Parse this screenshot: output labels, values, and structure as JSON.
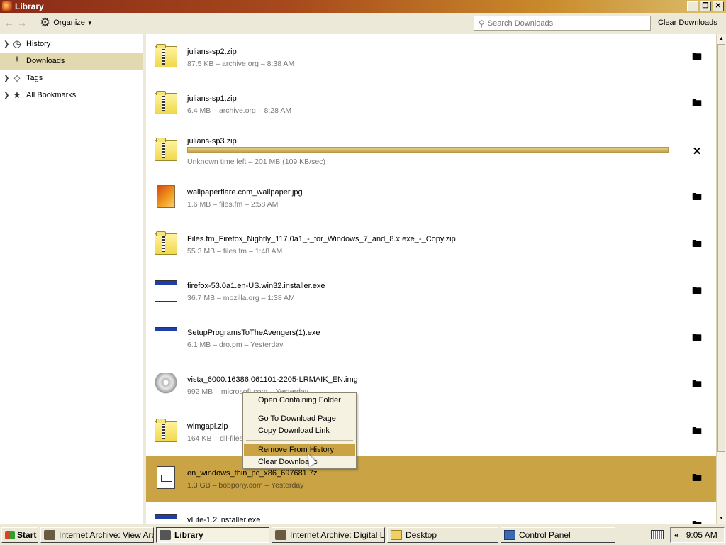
{
  "window": {
    "title": "Library"
  },
  "toolbar": {
    "organize_label": "Organize",
    "search_placeholder": "Search Downloads",
    "clear_label": "Clear Downloads"
  },
  "sidebar": {
    "items": [
      {
        "label": "History",
        "icon": "clock-icon",
        "selected": false
      },
      {
        "label": "Downloads",
        "icon": "download-icon",
        "selected": true
      },
      {
        "label": "Tags",
        "icon": "tag-icon",
        "selected": false
      },
      {
        "label": "All Bookmarks",
        "icon": "star-icon",
        "selected": false
      }
    ]
  },
  "downloads": [
    {
      "name": "julians-sp2.zip",
      "meta": "87.5 KB – archive.org – 8:38 AM",
      "icon": "zip-icon"
    },
    {
      "name": "julians-sp1.zip",
      "meta": "6.4 MB – archive.org – 8:28 AM",
      "icon": "zip-icon"
    },
    {
      "name": "julians-sp3.zip",
      "meta": "Unknown time left – 201 MB (109 KB/sec)",
      "icon": "zip-icon",
      "in_progress": true,
      "progress": 1.0
    },
    {
      "name": "wallpaperflare.com_wallpaper.jpg",
      "meta": "1.6 MB – files.fm – 2:58 AM",
      "icon": "image-icon"
    },
    {
      "name": "Files.fm_Firefox_Nightly_117.0a1_-_for_Windows_7_and_8.x.exe_-_Copy.zip",
      "meta": "55.3 MB – files.fm – 1:48 AM",
      "icon": "zip-icon"
    },
    {
      "name": "firefox-53.0a1.en-US.win32.installer.exe",
      "meta": "36.7 MB – mozilla.org – 1:38 AM",
      "icon": "exe-icon"
    },
    {
      "name": "SetupProgramsToTheAvengers(1).exe",
      "meta": "6.1 MB – dro.pm – Yesterday",
      "icon": "exe-icon"
    },
    {
      "name": "vista_6000.16386.061101-2205-LRMAIK_EN.img",
      "meta": "992 MB – microsoft.com – Yesterday",
      "icon": "disc-icon"
    },
    {
      "name": "wimgapi.zip",
      "meta": "164 KB – dll-files",
      "icon": "zip-icon"
    },
    {
      "name": "en_windows_thin_pc_x86_697681.7z",
      "meta": "1.3 GB – bobpony.com – Yesterday",
      "icon": "document-icon",
      "selected": true
    },
    {
      "name": "vLite-1.2.installer.exe",
      "meta": "",
      "icon": "exe-icon"
    }
  ],
  "context_menu": {
    "items": [
      "Open Containing Folder",
      "Go To Download Page",
      "Copy Download Link",
      "Remove From History",
      "Clear Downloads"
    ],
    "highlighted": "Remove From History"
  },
  "taskbar": {
    "start_label": "Start",
    "tasks": [
      "Internet Archive: View Arc...",
      "Library",
      "Internet Archive: Digital Li...",
      "Desktop",
      "Control Panel"
    ],
    "active_task": "Library",
    "clock": "9:05 AM",
    "chevron": "«"
  },
  "colors": {
    "accent": "#c9a344",
    "title_start": "#8a2a18",
    "title_end": "#dcc070"
  }
}
